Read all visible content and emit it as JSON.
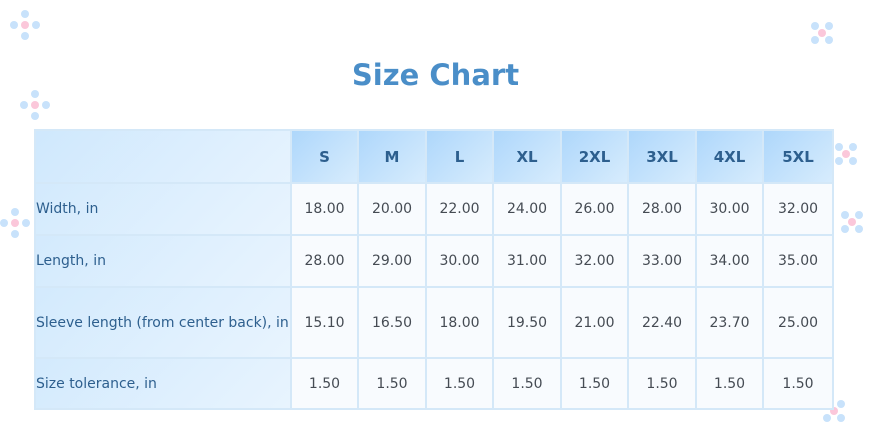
{
  "title": "Size Chart",
  "sizes": [
    "S",
    "M",
    "L",
    "XL",
    "2XL",
    "3XL",
    "4XL",
    "5XL"
  ],
  "rows": [
    {
      "label": "Width, in",
      "values": [
        "18.00",
        "20.00",
        "22.00",
        "24.00",
        "26.00",
        "28.00",
        "30.00",
        "32.00"
      ]
    },
    {
      "label": "Length, in",
      "values": [
        "28.00",
        "29.00",
        "30.00",
        "31.00",
        "32.00",
        "33.00",
        "34.00",
        "35.00"
      ]
    },
    {
      "label": "Sleeve length (from center back), in",
      "values": [
        "15.10",
        "16.50",
        "18.00",
        "19.50",
        "21.00",
        "22.40",
        "23.70",
        "25.00"
      ]
    },
    {
      "label": "Size tolerance, in",
      "values": [
        "1.50",
        "1.50",
        "1.50",
        "1.50",
        "1.50",
        "1.50",
        "1.50",
        "1.50"
      ]
    }
  ],
  "colors": {
    "title": "#4a8ec8",
    "header_text": "#2d5f8e",
    "cell_text": "#454b53",
    "border": "#d4e8f8"
  }
}
